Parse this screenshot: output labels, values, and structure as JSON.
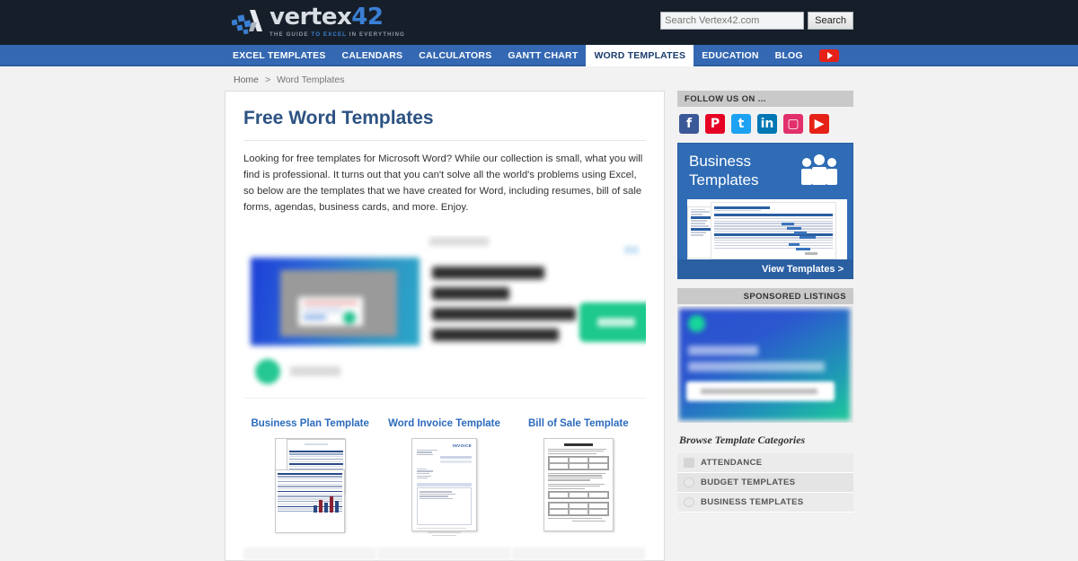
{
  "site": {
    "logo_main": "vertex",
    "logo_accent": "42",
    "tagline_pre": "THE GUIDE ",
    "tagline_hl": "TO EXCEL",
    "tagline_post": " IN EVERYTHING"
  },
  "search": {
    "placeholder": "Search Vertex42.com",
    "value": "",
    "button": "Search"
  },
  "nav": {
    "items": [
      {
        "label": "EXCEL TEMPLATES",
        "active": false
      },
      {
        "label": "CALENDARS",
        "active": false
      },
      {
        "label": "CALCULATORS",
        "active": false
      },
      {
        "label": "GANTT CHART",
        "active": false
      },
      {
        "label": "WORD TEMPLATES",
        "active": true
      },
      {
        "label": "EDUCATION",
        "active": false
      },
      {
        "label": "BLOG",
        "active": false
      }
    ],
    "youtube_icon": "youtube-play-icon"
  },
  "breadcrumb": {
    "home": "Home",
    "separator": ">",
    "current": "Word Templates"
  },
  "main": {
    "title": "Free Word Templates",
    "intro": "Looking for free templates for Microsoft Word? While our collection is small, what you will find is professional. It turns out that you can't solve all the world's problems using Excel, so below are the templates that we have created for Word, including resumes, bill of sale forms, agendas, business cards, and more. Enjoy.",
    "cards": [
      {
        "title": "Business Plan Template",
        "thumb": "business-plan-document-thumbnail"
      },
      {
        "title": "Word Invoice Template",
        "thumb": "invoice-document-thumbnail",
        "doc_heading": "INVOICE"
      },
      {
        "title": "Bill of Sale Template",
        "thumb": "bill-of-sale-document-thumbnail"
      }
    ]
  },
  "sidebar": {
    "follow_header": "FOLLOW US ON ...",
    "social": [
      {
        "name": "facebook-icon",
        "glyph": "f"
      },
      {
        "name": "pinterest-icon",
        "glyph": "P"
      },
      {
        "name": "twitter-icon",
        "glyph": "t"
      },
      {
        "name": "linkedin-icon",
        "glyph": "in"
      },
      {
        "name": "instagram-icon",
        "glyph": "▢"
      },
      {
        "name": "youtube-icon",
        "glyph": "▶"
      }
    ],
    "business_ad": {
      "line1": "Business",
      "line2": "Templates",
      "cta": "View Templates  >"
    },
    "sponsored_header": "SPONSORED LISTINGS",
    "categories_title": "Browse Template Categories",
    "categories": [
      {
        "label": "ATTENDANCE",
        "icon": "calendar-icon"
      },
      {
        "label": "BUDGET TEMPLATES",
        "icon": "pie-chart-icon"
      },
      {
        "label": "BUSINESS TEMPLATES",
        "icon": "briefcase-icon"
      }
    ]
  },
  "colors": {
    "header_bg": "#161f29",
    "nav_bg": "#3468b2",
    "accent_blue": "#2c6bbd",
    "title_blue": "#2c5282",
    "page_bg": "#f2f2f2"
  }
}
